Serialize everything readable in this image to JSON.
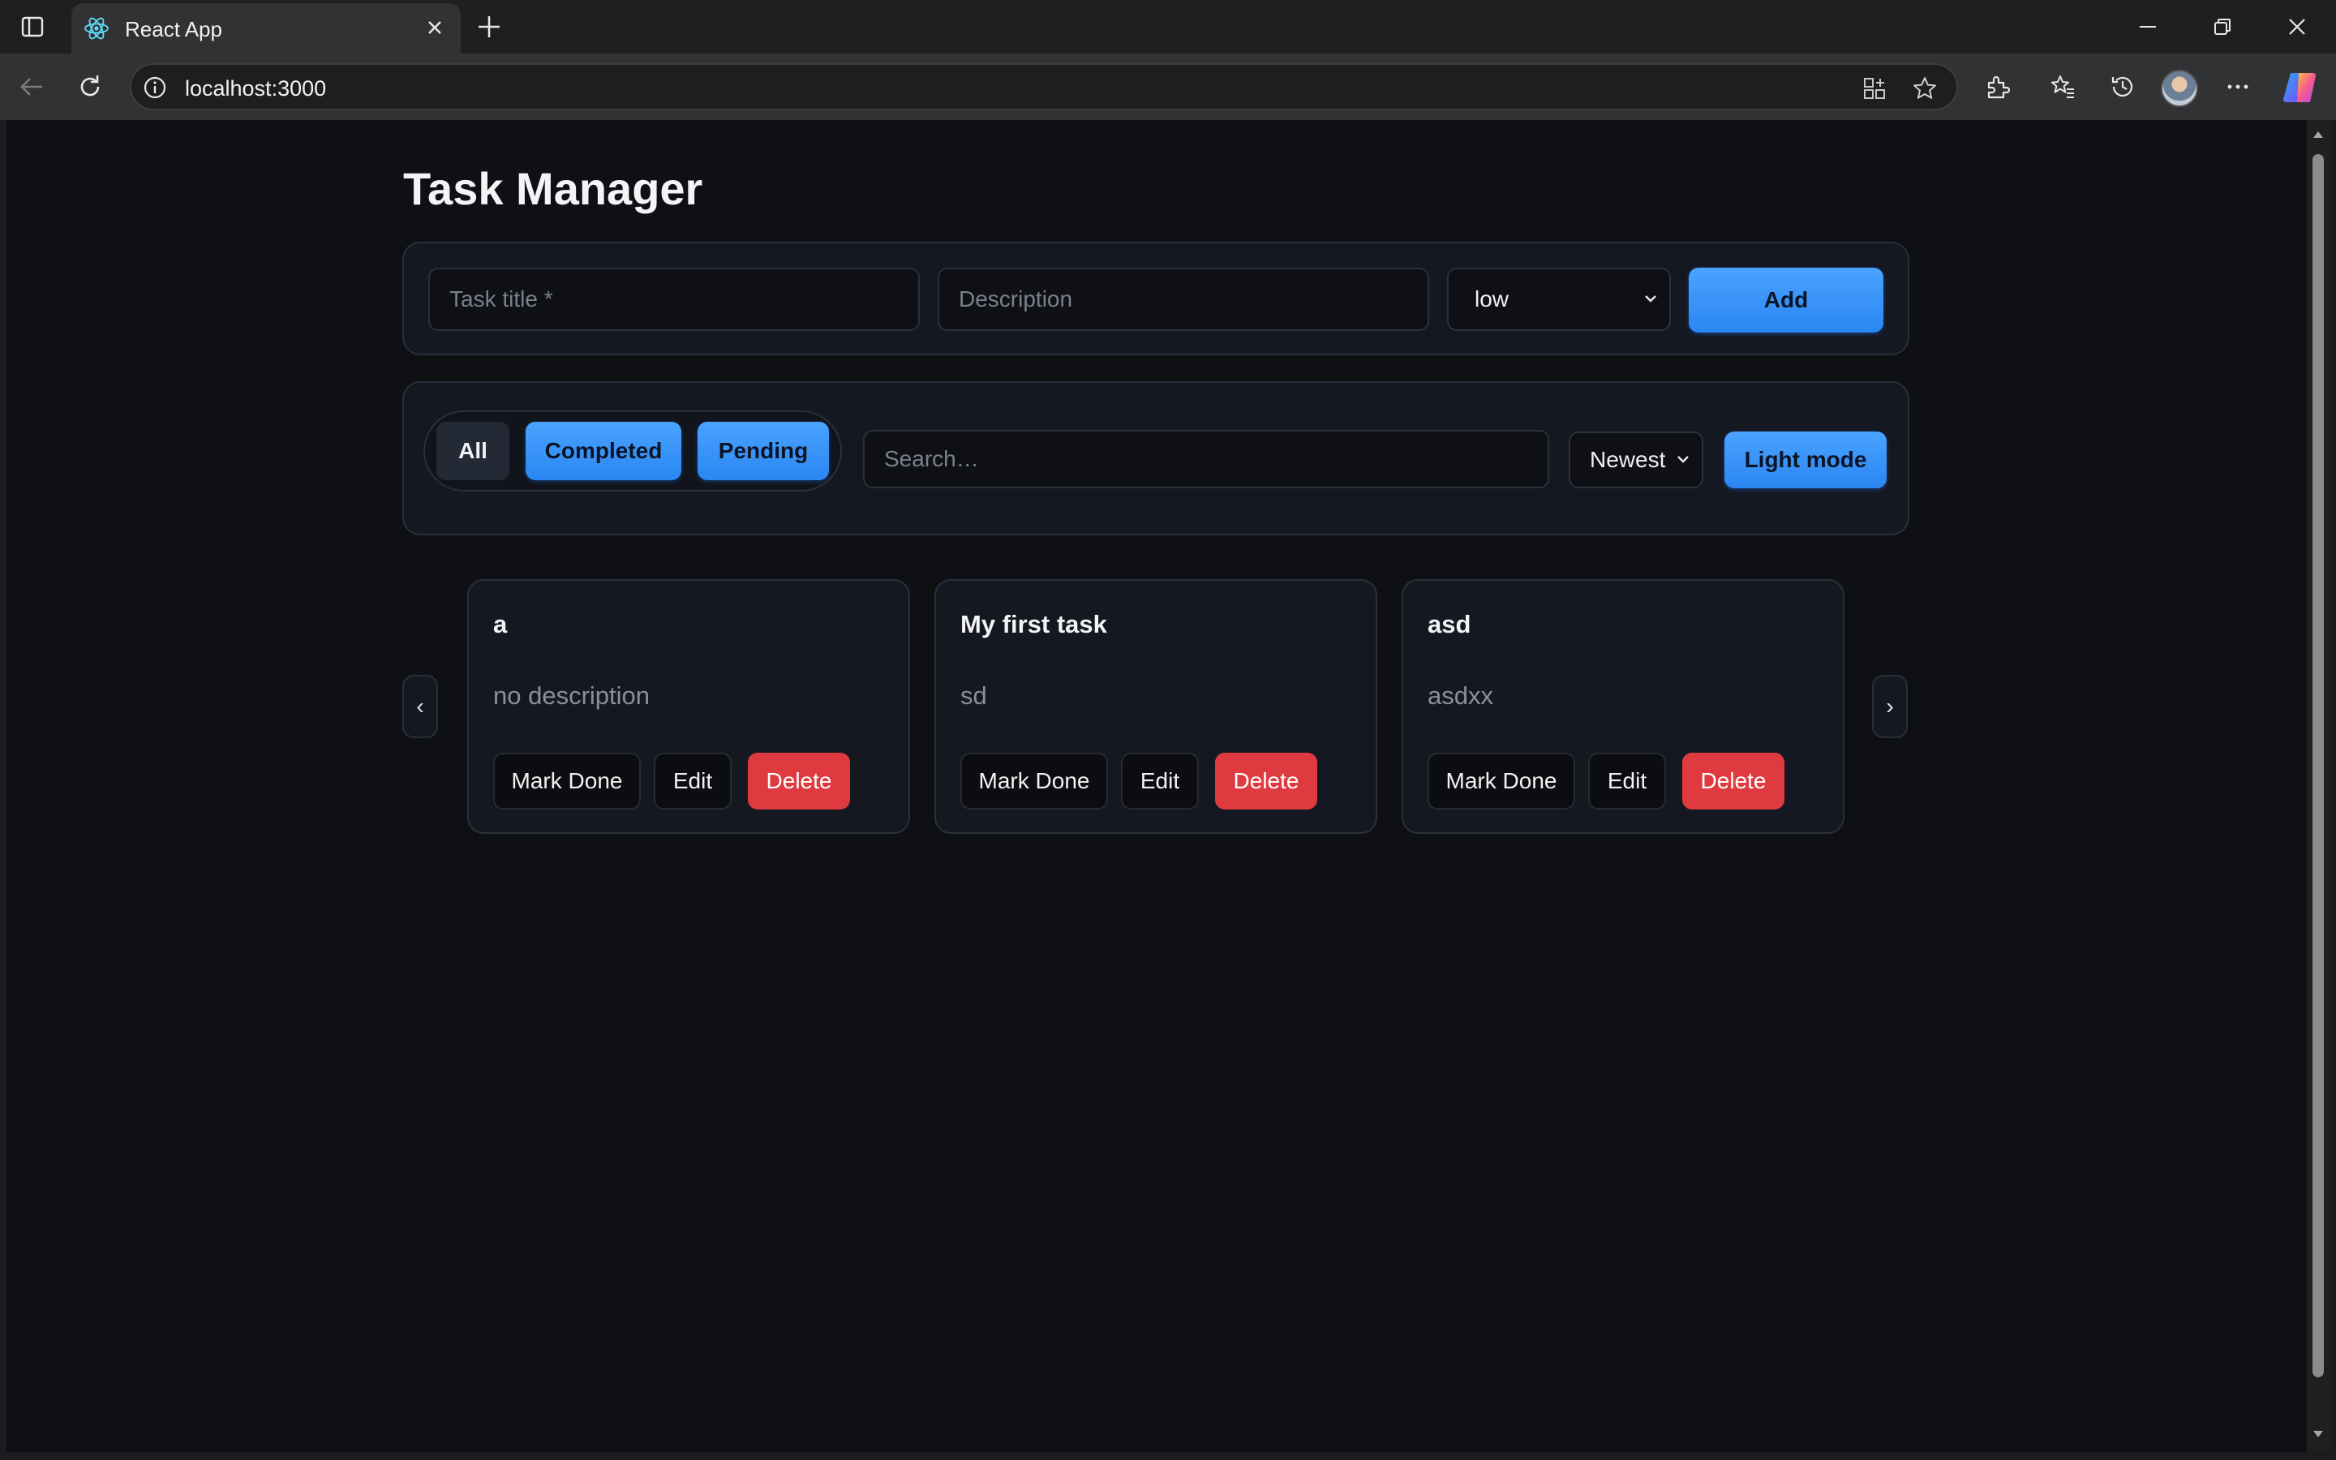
{
  "browser": {
    "tab_title": "React App",
    "url": "localhost:3000"
  },
  "app": {
    "title": "Task Manager",
    "form": {
      "title_placeholder": "Task title *",
      "description_placeholder": "Description",
      "priority_value": "low",
      "add_label": "Add"
    },
    "filters": {
      "all_label": "All",
      "completed_label": "Completed",
      "pending_label": "Pending",
      "search_placeholder": "Search…",
      "sort_value": "Newest",
      "theme_label": "Light mode"
    },
    "carousel": {
      "prev_label": "‹",
      "next_label": "›"
    },
    "tasks": [
      {
        "title": "a",
        "description": "no description",
        "mark_done_label": "Mark Done",
        "edit_label": "Edit",
        "delete_label": "Delete"
      },
      {
        "title": "My first task",
        "description": "sd",
        "mark_done_label": "Mark Done",
        "edit_label": "Edit",
        "delete_label": "Delete"
      },
      {
        "title": "asd",
        "description": "asdxx",
        "mark_done_label": "Mark Done",
        "edit_label": "Edit",
        "delete_label": "Delete"
      }
    ]
  },
  "colors": {
    "page_bg": "#0e1014",
    "panel_bg": "#151821",
    "accent_blue": "#3b97f9",
    "danger_red": "#df3a3f"
  }
}
